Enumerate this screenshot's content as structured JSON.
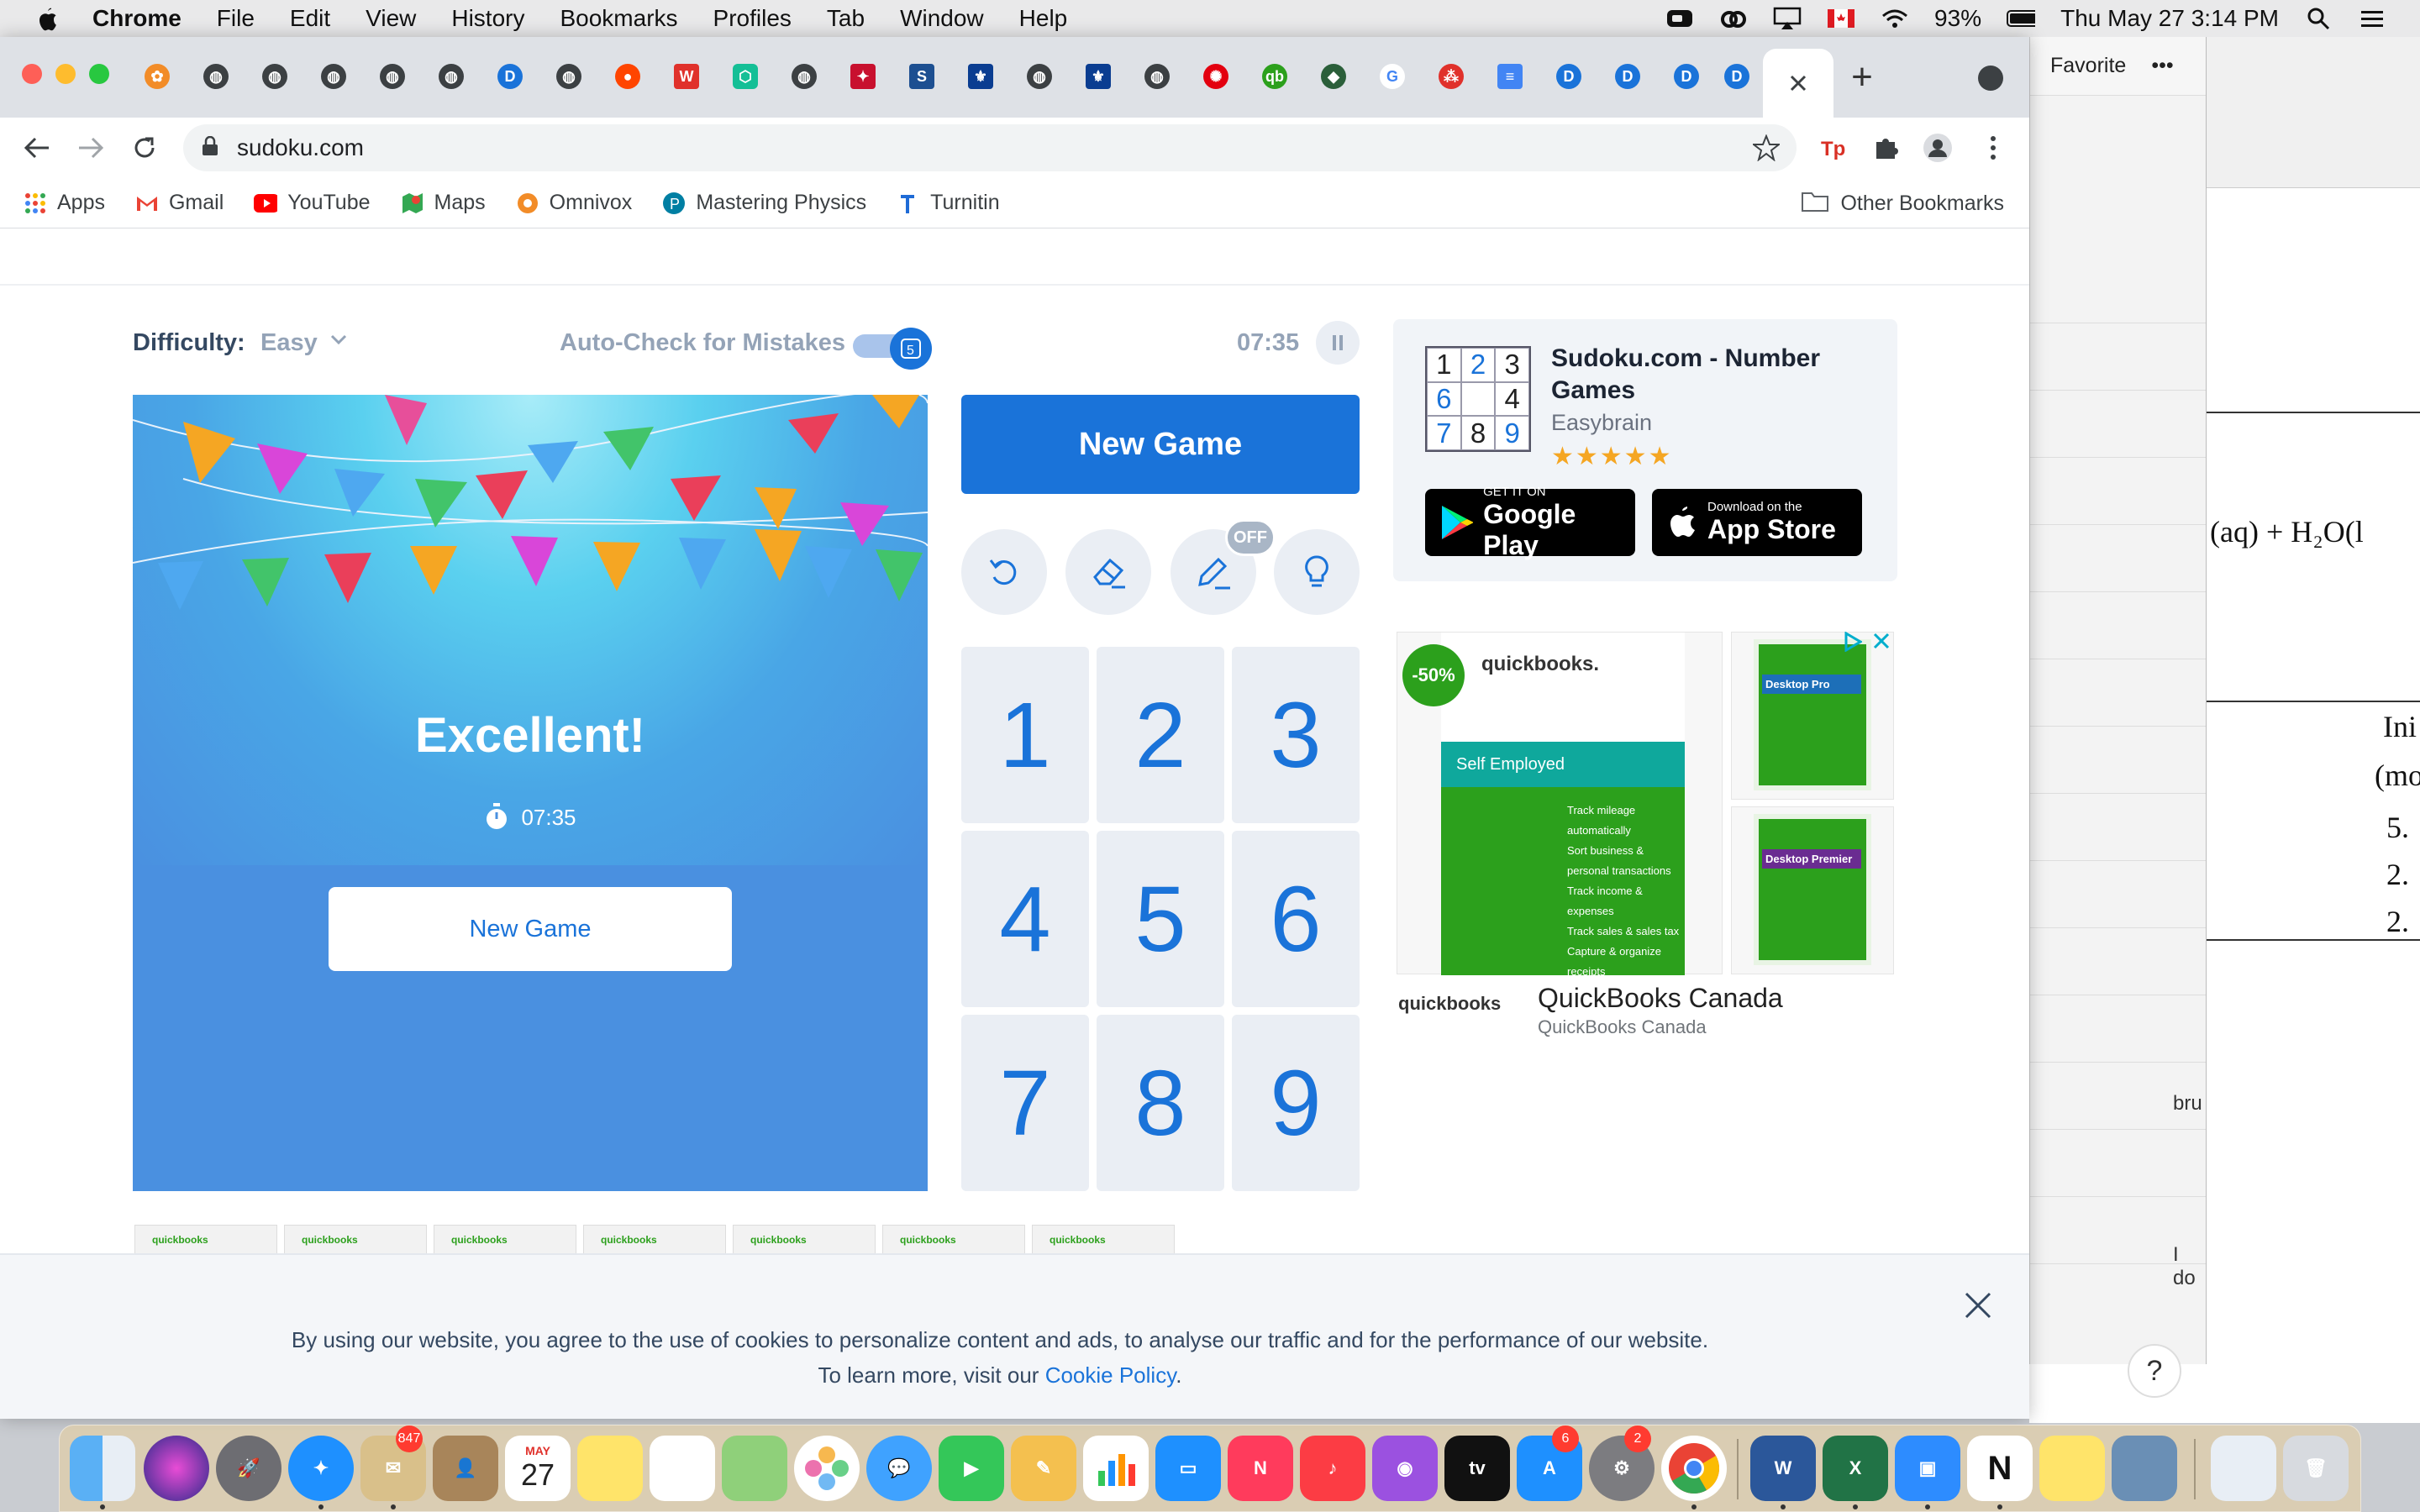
{
  "menubar": {
    "app_name": "Chrome",
    "items": [
      "File",
      "Edit",
      "View",
      "History",
      "Bookmarks",
      "Profiles",
      "Tab",
      "Window",
      "Help"
    ],
    "battery": "93%",
    "datetime": "Thu May 27  3:14 PM"
  },
  "browser": {
    "url": "sudoku.com",
    "bookmarks": [
      {
        "label": "Apps",
        "icon": "apps-grid-icon"
      },
      {
        "label": "Gmail",
        "icon": "gmail-icon"
      },
      {
        "label": "YouTube",
        "icon": "youtube-icon"
      },
      {
        "label": "Maps",
        "icon": "maps-icon"
      },
      {
        "label": "Omnivox",
        "icon": "omnivox-icon"
      },
      {
        "label": "Mastering Physics",
        "icon": "pearson-icon"
      },
      {
        "label": "Turnitin",
        "icon": "turnitin-icon"
      }
    ],
    "other_bookmarks": "Other Bookmarks",
    "tab_count_visible": 29
  },
  "game": {
    "difficulty_label": "Difficulty:",
    "difficulty_value": "Easy",
    "autocheck_label": "Auto-Check for Mistakes",
    "autocheck_on": true,
    "timer": "07:35",
    "result_title": "Excellent!",
    "result_time": "07:35",
    "board_new_game": "New Game",
    "new_game": "New Game",
    "pencil_badge": "OFF",
    "numbers": [
      "1",
      "2",
      "3",
      "4",
      "5",
      "6",
      "7",
      "8",
      "9"
    ]
  },
  "app_promo": {
    "title": "Sudoku.com - Number Games",
    "developer": "Easybrain",
    "rating": 4.5,
    "stars": "★★★★★",
    "grid": [
      "1",
      "2",
      "3",
      "6",
      "",
      "4",
      "7",
      "8",
      "9"
    ],
    "google_play_small": "GET IT ON",
    "google_play_big": "Google Play",
    "app_store_small": "Download on the",
    "app_store_big": "App Store"
  },
  "ad": {
    "discount": "-50%",
    "brand": "quickbooks.",
    "band": "Self Employed",
    "features": [
      "Track mileage automatically",
      "Sort business & personal transactions",
      "Track income & expenses",
      "Track sales & sales tax",
      "Capture & organize receipts"
    ],
    "side_products": [
      "Desktop Pro",
      "Desktop Premier"
    ],
    "footer_logo": "quickbooks",
    "footer_title": "QuickBooks Canada",
    "footer_sub": "QuickBooks Canada",
    "strip_label": "quickbooks"
  },
  "cookie": {
    "line1": "By using our website, you agree to the use of cookies to personalize content and ads, to analyse our traffic and for the performance of our website.",
    "line2_prefix": "To learn more, visit our ",
    "link": "Cookie Policy",
    "line2_suffix": "."
  },
  "background_app": {
    "favorite": "Favorite",
    "more": "•••",
    "equation": "(aq)  +  H₂O(l",
    "header1": "Ini",
    "header2": "(mo",
    "values": [
      "5.",
      "2.",
      "2."
    ],
    "notes": [
      "bru",
      "I do"
    ],
    "help": "?"
  },
  "dock": {
    "calendar_month": "MAY",
    "calendar_day": "27",
    "badges": {
      "mail": "847",
      "appstore": "6",
      "settings": "2"
    }
  }
}
